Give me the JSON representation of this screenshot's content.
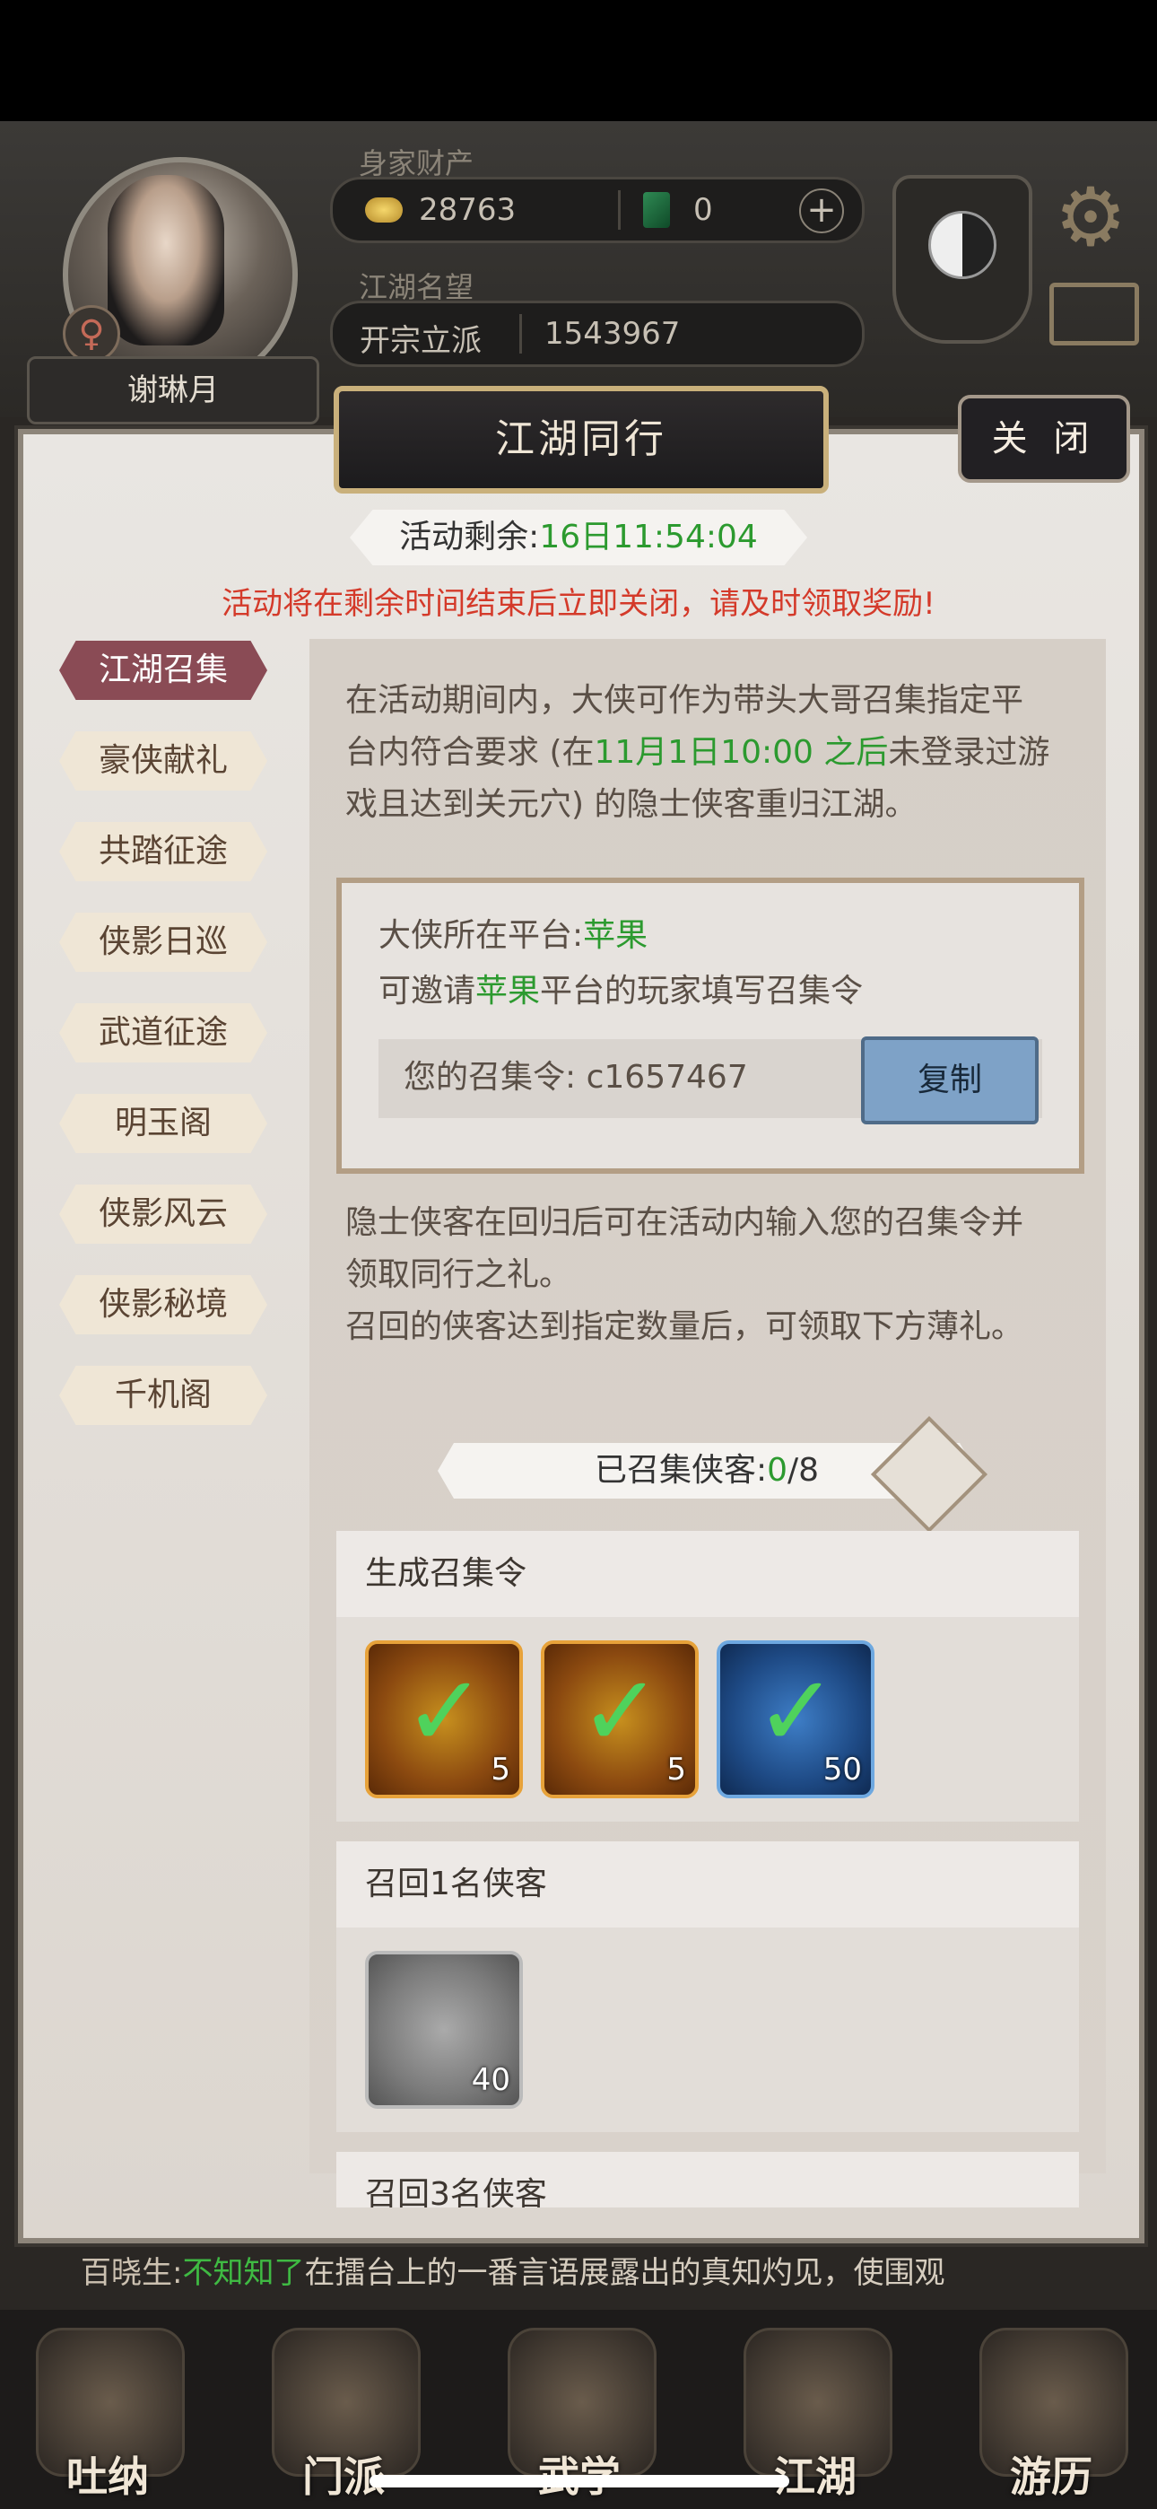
{
  "hud": {
    "assets_label": "身家财产",
    "gold": "28763",
    "jade": "0",
    "fame_label": "江湖名望",
    "rank": "开宗立派",
    "fame_value": "1543967",
    "player_name": "谢琳月",
    "gender_symbol": "♀"
  },
  "modal": {
    "title": "江湖同行",
    "close_label": "关 闭",
    "timer_label": "活动剩余:",
    "timer_value": "16日11:54:04",
    "warning": "活动将在剩余时间结束后立即关闭，请及时领取奖励!"
  },
  "sidebar": {
    "items": [
      {
        "label": "江湖召集"
      },
      {
        "label": "豪侠献礼"
      },
      {
        "label": "共踏征途"
      },
      {
        "label": "侠影日巡"
      },
      {
        "label": "武道征途"
      },
      {
        "label": "明玉阁"
      },
      {
        "label": "侠影风云"
      },
      {
        "label": "侠影秘境"
      },
      {
        "label": "千机阁"
      }
    ]
  },
  "content": {
    "intro_1": "在活动期间内，大侠可作为带头大哥召集指定平",
    "intro_2a": "台内符合要求 (在",
    "intro_2b": "11月1日10:00 之后",
    "intro_2c": "未登录过游",
    "intro_3": "戏且达到关元穴) 的隐士侠客重归江湖。",
    "platform_label": "大侠所在平台:",
    "platform_value": "苹果",
    "invite_a": "可邀请",
    "invite_b": "苹果",
    "invite_c": "平台的玩家填写召集令",
    "code_label": "您的召集令:",
    "code_value": "c1657467",
    "copy_label": "复制",
    "note_1": "隐士侠客在回归后可在活动内输入您的召集令并",
    "note_2": "领取同行之礼。",
    "note_3": "召回的侠客达到指定数量后，可领取下方薄礼。",
    "collected_label": "已召集侠客:",
    "collected_current": "0",
    "collected_total": "/8"
  },
  "rewards": [
    {
      "title": "生成召集令",
      "items": [
        {
          "qty": "5",
          "frame": "orange",
          "claimed": true
        },
        {
          "qty": "5",
          "frame": "orange",
          "claimed": true
        },
        {
          "qty": "50",
          "frame": "blue",
          "claimed": true
        }
      ]
    },
    {
      "title": "召回1名侠客",
      "items": [
        {
          "qty": "40",
          "frame": "gray",
          "claimed": false
        }
      ]
    },
    {
      "title": "召回3名侠客",
      "items": []
    }
  ],
  "news": {
    "speaker": "百晓生:",
    "highlight": "不知知了",
    "text": "在擂台上的一番言语展露出的真知灼见，使围观"
  },
  "nav": {
    "items": [
      {
        "label": "吐纳"
      },
      {
        "label": "门派"
      },
      {
        "label": "武学"
      },
      {
        "label": "江湖"
      },
      {
        "label": "游历"
      }
    ]
  },
  "colors": {
    "accent_green": "#2c9a2f",
    "warning_red": "#d43a2a",
    "active_tab": "#8a4b55",
    "copy_button": "#7ea2c7"
  }
}
